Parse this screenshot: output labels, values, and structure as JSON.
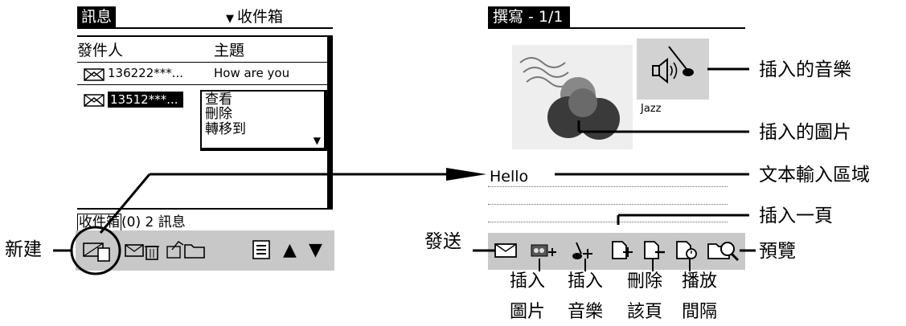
{
  "left_screen": {
    "title": "訊息",
    "folder": "收件箱",
    "columns": {
      "sender": "發件人",
      "subject": "主題"
    },
    "rows": [
      {
        "sender": "136222***...",
        "subject": "How are you"
      },
      {
        "sender": "13512***..."
      }
    ],
    "context_menu": [
      "查看",
      "刪除",
      "轉移到"
    ],
    "status": {
      "folder": "收件箱",
      "rest": "(0) 2 訊息"
    }
  },
  "right_screen": {
    "title": "撰寫 - 1/1",
    "music_caption": "Jazz",
    "text_value": "Hello"
  },
  "labels": {
    "new": "新建",
    "send": "發送",
    "inserted_music": "插入的音樂",
    "inserted_picture": "插入的圖片",
    "text_area": "文本輸入區域",
    "insert_page": "插入一頁",
    "preview": "預覽",
    "insert_picture": [
      "插入",
      "圖片"
    ],
    "insert_music": [
      "插入",
      "音樂"
    ],
    "delete_page": [
      "刪除",
      "該頁"
    ],
    "play_interval": [
      "播放",
      "間隔"
    ]
  },
  "icons": [
    "envelope-icon",
    "trash-icon",
    "folder-icon",
    "list-icon",
    "up-arrow-icon",
    "down-arrow-icon",
    "add-picture-icon",
    "add-music-icon",
    "add-page-icon",
    "delete-page-icon",
    "interval-icon",
    "preview-icon",
    "speaker-icon"
  ]
}
